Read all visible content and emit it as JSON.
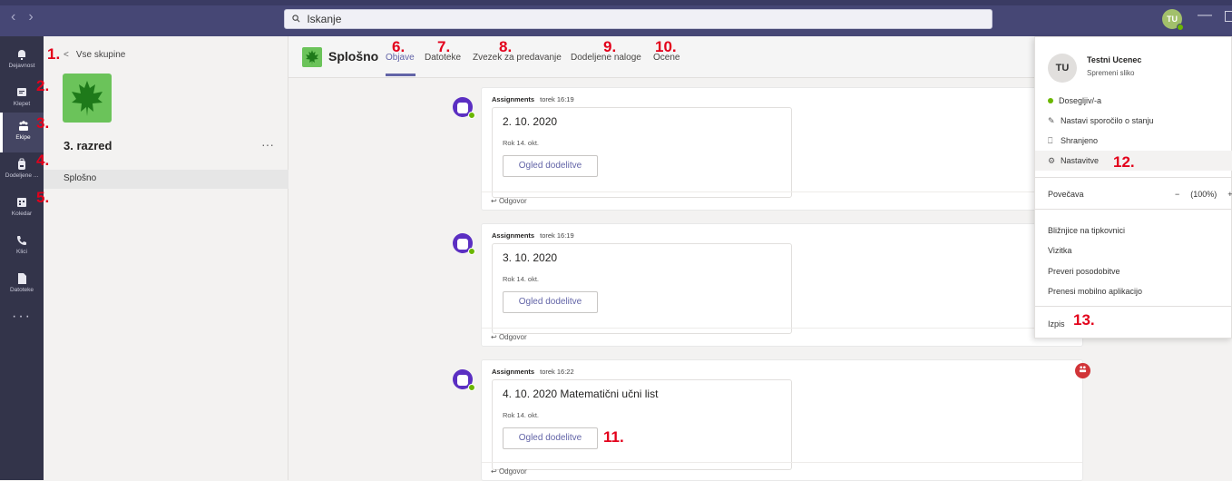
{
  "topbar": {
    "back_glyph": "‹",
    "forward_glyph": "›",
    "search_placeholder": "Iskanje",
    "user_initials": "TU",
    "minimize_glyph": "—"
  },
  "rail": {
    "items": [
      {
        "label": "Dejavnost",
        "icon": "bell-icon"
      },
      {
        "label": "Klepet",
        "icon": "chat-icon"
      },
      {
        "label": "Ekipe",
        "icon": "teams-icon"
      },
      {
        "label": "Dodeljene ...",
        "icon": "backpack-icon"
      },
      {
        "label": "Koledar",
        "icon": "calendar-icon"
      },
      {
        "label": "Klici",
        "icon": "phone-icon"
      },
      {
        "label": "Datoteke",
        "icon": "file-icon"
      }
    ],
    "more": "···"
  },
  "teampane": {
    "back_label": "Vse skupine",
    "team_name": "3. razred",
    "more": "···",
    "channel": "Splošno"
  },
  "channel": {
    "title": "Splošno",
    "tabs": [
      "Objave",
      "Datoteke",
      "Zvezek za predavanje",
      "Dodeljene naloge",
      "Ocene"
    ]
  },
  "posts": [
    {
      "author": "Assignments",
      "time": "torek 16:19",
      "title": "2. 10. 2020",
      "due": "Rok 14. okt.",
      "button": "Ogled dodelitve",
      "reply": "Odgovor"
    },
    {
      "author": "Assignments",
      "time": "torek 16:19",
      "title": "3. 10. 2020",
      "due": "Rok 14. okt.",
      "button": "Ogled dodelitve",
      "reply": "Odgovor"
    },
    {
      "author": "Assignments",
      "time": "torek 16:22",
      "title": "4. 10. 2020 Matematični učni list",
      "due": "Rok 14. okt.",
      "button": "Ogled dodelitve",
      "reply": "Odgovor"
    }
  ],
  "profile_menu": {
    "initials": "TU",
    "name": "Testni Ucenec",
    "change_photo": "Spremeni sliko",
    "status": "Dosegljiv/-a",
    "set_status": "Nastavi sporočilo o stanju",
    "saved": "Shranjeno",
    "settings": "Nastavitve",
    "zoom_label": "Povečava",
    "zoom_minus": "−",
    "zoom_value": "(100%)",
    "zoom_plus": "+",
    "shortcuts": "Bližnjice na tipkovnici",
    "card": "Vizitka",
    "check_updates": "Preveri posodobitve",
    "mobile_app": "Prenesi mobilno aplikacijo",
    "sign_out": "Izpis"
  },
  "annotations": [
    "1.",
    "2.",
    "3.",
    "4.",
    "5.",
    "6.",
    "7.",
    "8.",
    "9.",
    "10.",
    "11.",
    "12.",
    "13."
  ],
  "colors": {
    "accent": "#6264a7",
    "topbar": "#464775",
    "rail": "#33344a",
    "annotation": "#e3001b",
    "presence": "#6bb700",
    "bot": "#5b2fc2"
  }
}
